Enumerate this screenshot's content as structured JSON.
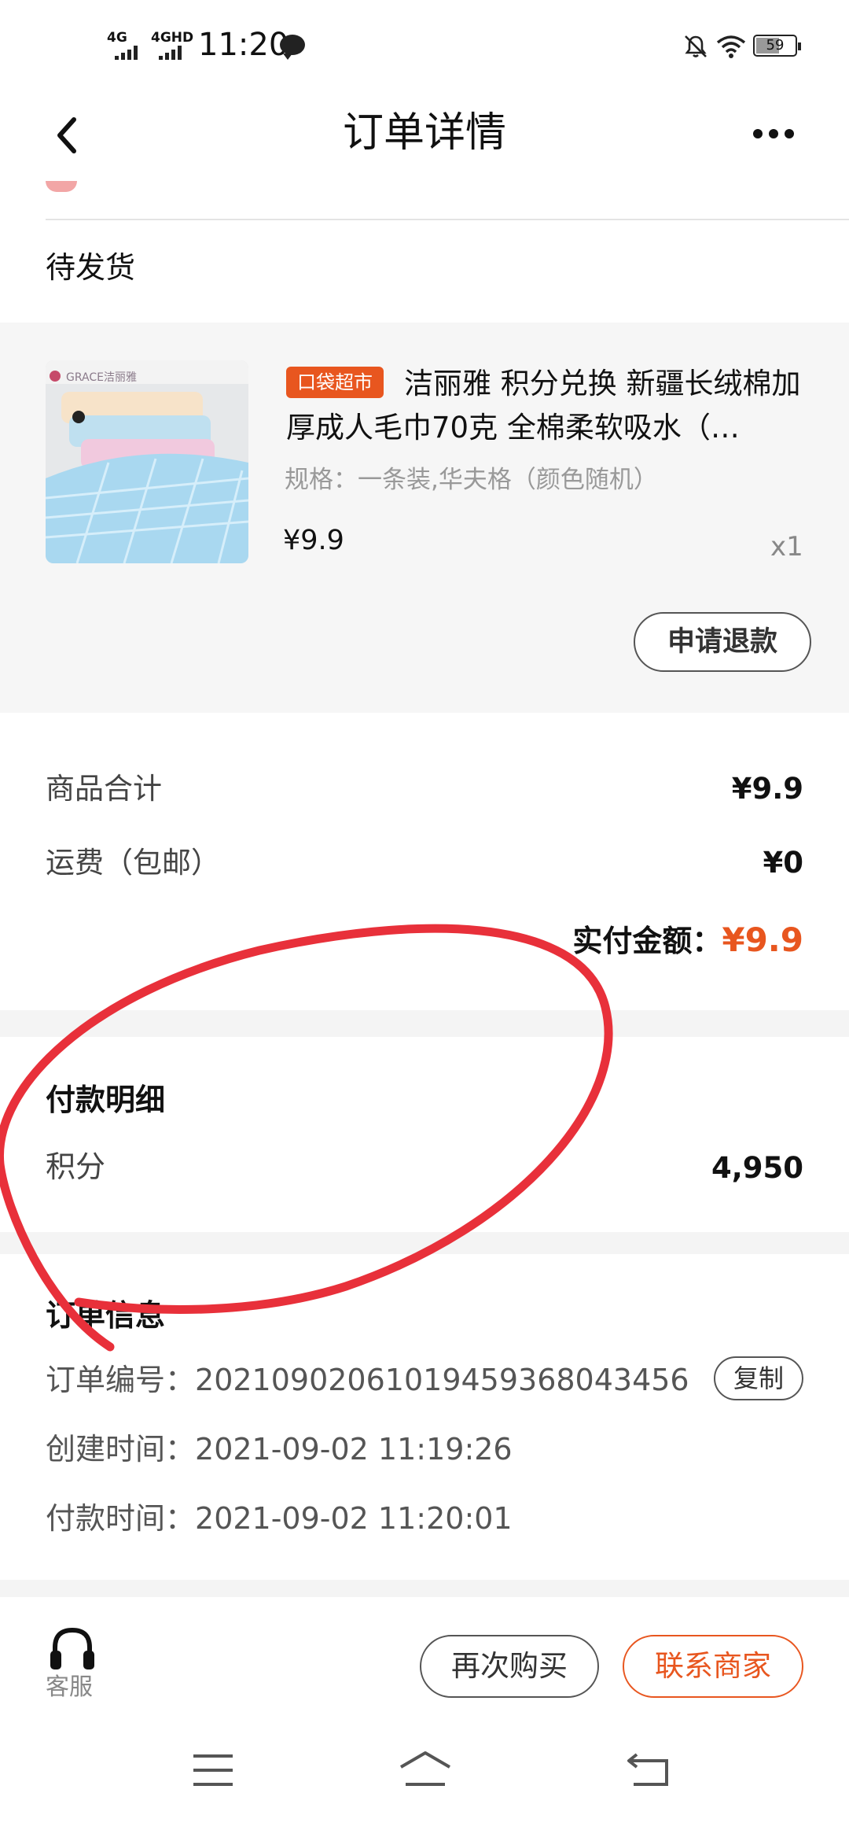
{
  "status_bar": {
    "signal1": "4G",
    "signal2": "4GHD",
    "time": "11:20",
    "battery": "59"
  },
  "nav": {
    "title": "订单详情"
  },
  "order": {
    "status": "待发货"
  },
  "product": {
    "brand_logo": "GRACE洁丽雅",
    "tag": "口袋超市",
    "title": "洁丽雅 积分兑换 新疆长绒棉加厚成人毛巾70克 全棉柔软吸水（…",
    "spec": "规格：一条装,华夫格（颜色随机）",
    "price": "¥9.9",
    "quantity": "x1",
    "refund_label": "申请退款"
  },
  "summary": {
    "goods_total_label": "商品合计",
    "goods_total_value": "¥9.9",
    "shipping_label": "运费（包邮）",
    "shipping_value": "¥0",
    "paid_label": "实付金额：",
    "paid_value": "¥9.9"
  },
  "payment_detail": {
    "title": "付款明细",
    "points_label": "积分",
    "points_value": "4,950"
  },
  "order_info": {
    "title": "订单信息",
    "order_no_label": "订单编号：",
    "order_no": "20210902061019459368043456",
    "copy_label": "复制",
    "created_label": "创建时间：",
    "created": "2021-09-02 11:19:26",
    "paid_label": "付款时间：",
    "paid": "2021-09-02 11:20:01"
  },
  "bottom_bar": {
    "service_label": "客服",
    "rebuy_label": "再次购买",
    "contact_label": "联系商家"
  },
  "colors": {
    "accent": "#e8561f",
    "annotation": "#e8303a"
  }
}
